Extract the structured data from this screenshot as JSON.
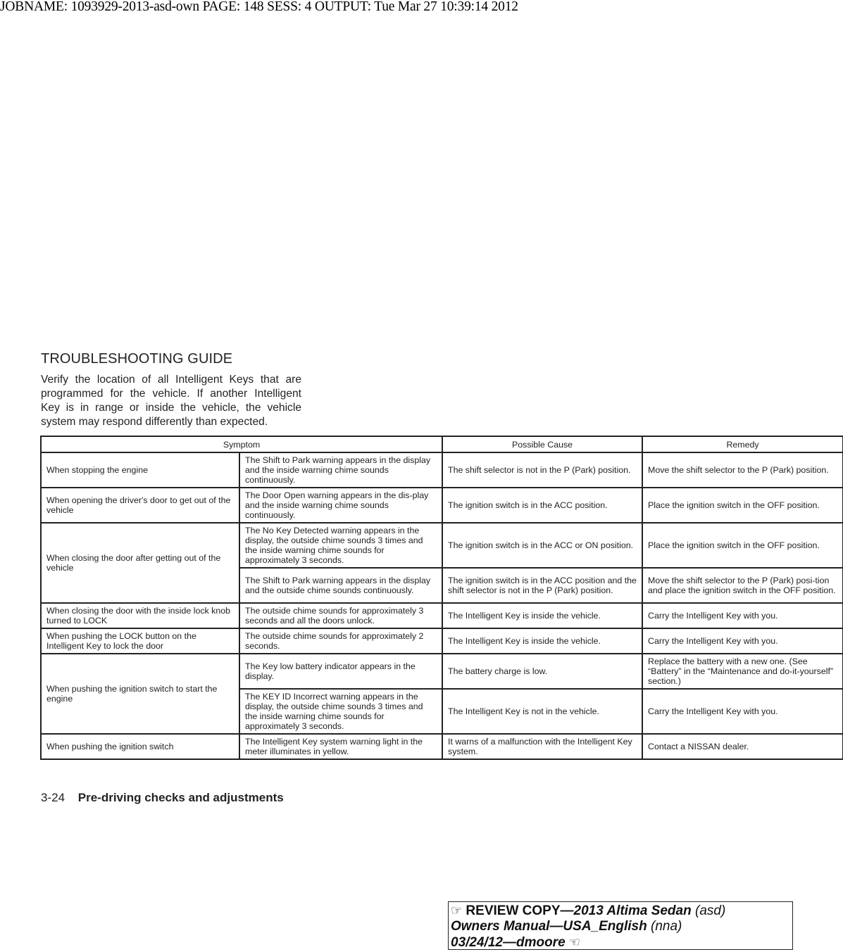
{
  "job_header": "JOBNAME: 1093929-2013-asd-own  PAGE: 148  SESS: 4  OUTPUT: Tue Mar 27 10:39:14 2012",
  "section": {
    "title": "TROUBLESHOOTING GUIDE",
    "intro_lines": [
      "Verify the location of all Intelligent Keys that are",
      "programmed for the vehicle. If another Intelligent",
      "Key is in range or inside the vehicle, the vehicle",
      "system may respond differently than expected."
    ]
  },
  "table": {
    "headers": {
      "symptom": "Symptom",
      "cause": "Possible Cause",
      "remedy": "Remedy"
    },
    "groups": [
      {
        "situation": "When stopping the engine",
        "rows": [
          {
            "indication": "The Shift to Park warning appears in the display and the inside warning chime sounds continuously.",
            "cause": "The shift selector is not in the P (Park) position.",
            "remedy": "Move the shift selector to the P (Park) position."
          }
        ]
      },
      {
        "situation": "When opening the driver's door to get out of the vehicle",
        "rows": [
          {
            "indication": "The Door Open warning appears in the dis-play and the inside warning chime sounds continuously.",
            "cause": "The ignition switch is in the ACC position.",
            "remedy": "Place the ignition switch in the OFF position."
          }
        ]
      },
      {
        "situation": "When closing the door after getting out of the vehicle",
        "rows": [
          {
            "indication": "The No Key Detected warning appears in the display, the outside chime sounds 3 times and the inside warning chime sounds for approximately 3 seconds.",
            "cause": "The ignition switch is in the ACC or ON position.",
            "remedy": "Place the ignition switch in the OFF position."
          },
          {
            "indication": "The Shift to Park warning appears in the display and the outside chime sounds continuously.",
            "cause": "The ignition switch is in the ACC position and the shift selector is not in the P (Park) position.",
            "remedy": "Move the shift selector to the P (Park) posi-tion and place the ignition switch in the OFF position."
          }
        ]
      },
      {
        "situation": "When closing the door with the inside lock knob turned to LOCK",
        "rows": [
          {
            "indication": "The outside chime sounds for approximately 3 seconds and all the doors unlock.",
            "cause": "The Intelligent Key is inside the vehicle.",
            "remedy": "Carry the Intelligent Key with you."
          }
        ]
      },
      {
        "situation": "When pushing the LOCK button on the Intelligent Key to lock the door",
        "rows": [
          {
            "indication": "The outside chime sounds for approximately 2 seconds.",
            "cause": "The Intelligent Key is inside the vehicle.",
            "remedy": "Carry the Intelligent Key with you."
          }
        ]
      },
      {
        "situation": "When pushing the ignition switch to start the engine",
        "rows": [
          {
            "indication": "The Key low battery indicator appears in the display.",
            "cause": "The battery charge is low.",
            "remedy": "Replace the battery with a new one. (See “Battery” in the “Maintenance and do-it-yourself” section.)"
          },
          {
            "indication": "The KEY ID Incorrect warning appears in the display, the outside chime sounds 3 times and the inside warning chime sounds for approximately 3 seconds.",
            "cause": "The Intelligent Key is not in the vehicle.",
            "remedy": "Carry the Intelligent Key with you."
          }
        ]
      },
      {
        "situation": "When pushing the ignition switch",
        "rows": [
          {
            "indication": "The Intelligent Key system warning light in the meter illuminates in yellow.",
            "cause": "It warns of a malfunction with the Intelligent Key system.",
            "remedy": "Contact a NISSAN dealer."
          }
        ]
      }
    ]
  },
  "footer": {
    "page_number": "3-24",
    "section_name": "Pre-driving checks and adjustments"
  },
  "review_box": {
    "pointer_icon": "☞",
    "line1_bold": "REVIEW COPY—",
    "line1_bold_italic": "2013 Altima Sedan",
    "line1_italic": " (asd)",
    "line2_bold_italic": "Owners Manual—USA_English",
    "line2_italic": " (nna)",
    "line3_bold_italic": "03/24/12—dmoore",
    "end_icon": "☜"
  }
}
